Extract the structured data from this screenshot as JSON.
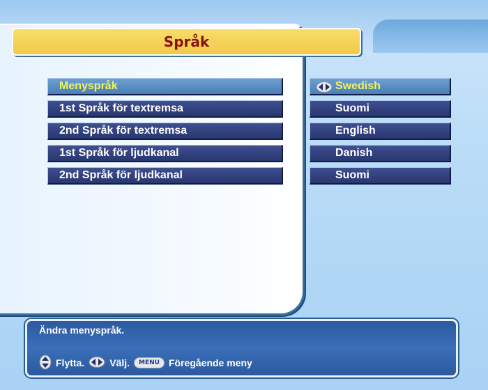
{
  "header": {
    "title": "Språk"
  },
  "menu": {
    "items": [
      {
        "label": "Menyspråk",
        "value": "Swedish",
        "selected": true
      },
      {
        "label": "1st Språk för textremsa",
        "value": "Suomi",
        "selected": false
      },
      {
        "label": "2nd Språk för textremsa",
        "value": "English",
        "selected": false
      },
      {
        "label": "1st Språk för ljudkanal",
        "value": "Danish",
        "selected": false
      },
      {
        "label": "2nd Språk för ljudkanal",
        "value": "Suomi",
        "selected": false
      }
    ]
  },
  "info": {
    "help": "Ändra menyspråk.",
    "nav": {
      "move": "Flytta.",
      "select": "Välj.",
      "menu_key": "MENU",
      "previous": "Föregående meny"
    }
  },
  "colors": {
    "title_text": "#8a1010",
    "title_bar": "#f0c94a",
    "row_bg": "#2f3f7e",
    "selected_row_bg": "#5b8dc4",
    "selected_text": "#f2f25a"
  },
  "icons": {
    "value_arrows": "left-right-arrows-icon",
    "move": "up-down-arrows-icon",
    "select": "left-right-arrows-icon",
    "menu": "menu-key-icon"
  }
}
